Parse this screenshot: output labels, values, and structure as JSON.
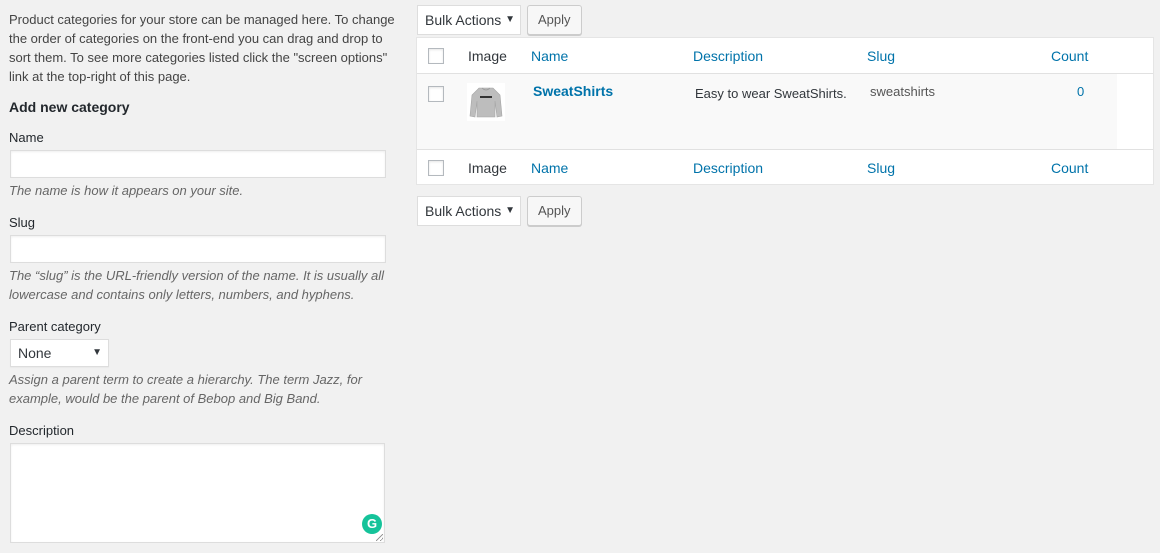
{
  "intro": "Product categories for your store can be managed here. To change the order of categories on the front-end you can drag and drop to sort them. To see more categories listed click the \"screen options\" link at the top-right of this page.",
  "form": {
    "title": "Add new category",
    "name_label": "Name",
    "name_value": "",
    "name_help": "The name is how it appears on your site.",
    "slug_label": "Slug",
    "slug_value": "",
    "slug_help": "The “slug” is the URL-friendly version of the name. It is usually all lowercase and contains only letters, numbers, and hyphens.",
    "parent_label": "Parent category",
    "parent_selected": "None",
    "parent_help": "Assign a parent term to create a hierarchy. The term Jazz, for example, would be the parent of Bebop and Big Band.",
    "description_label": "Description",
    "description_value": ""
  },
  "bulk_top": {
    "select": "Bulk Actions",
    "apply": "Apply"
  },
  "bulk_bottom": {
    "select": "Bulk Actions",
    "apply": "Apply"
  },
  "table": {
    "columns": {
      "image": "Image",
      "name": "Name",
      "description": "Description",
      "slug": "Slug",
      "count": "Count"
    },
    "rows": [
      {
        "name": "SweatShirts",
        "description": "Easy to wear SweatShirts.",
        "slug": "sweatshirts",
        "count": "0"
      }
    ]
  },
  "colors": {
    "link": "#0073aa",
    "background": "#f1f1f1",
    "grammarly": "#15c39a"
  },
  "icons": {
    "dropdown": "dropdown-arrow-icon",
    "grammarly": "grammarly-icon"
  }
}
